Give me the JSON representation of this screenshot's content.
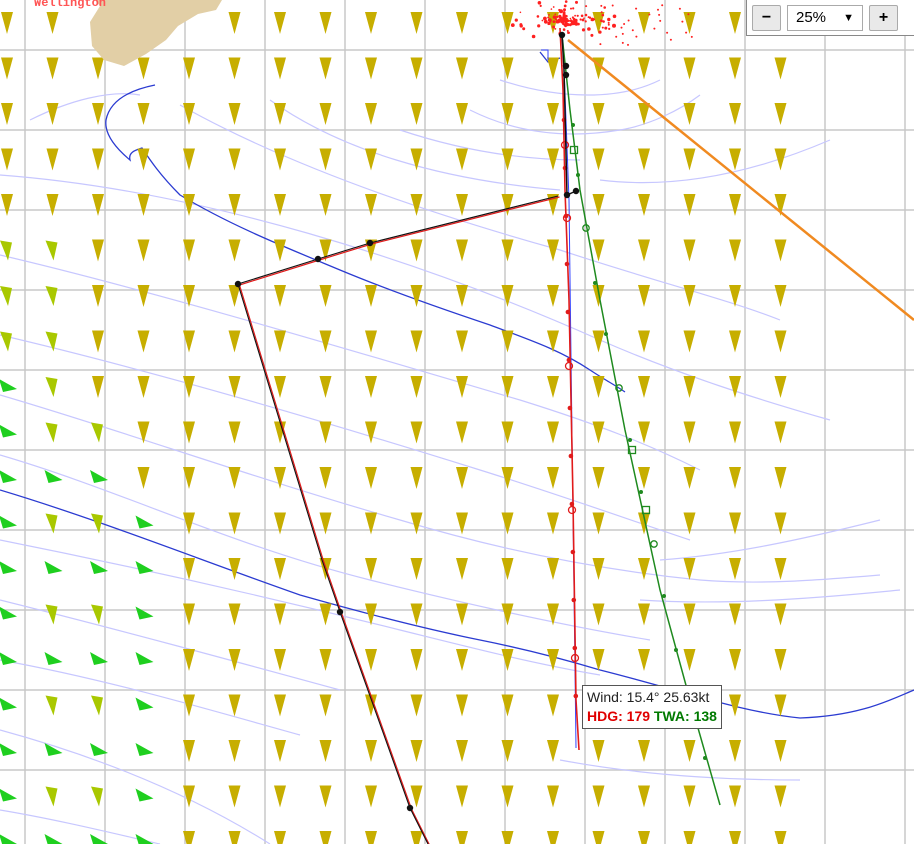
{
  "map": {
    "place_label": "Wellington",
    "colors": {
      "land": "#e2cfa6",
      "grid": "#c8c8c8",
      "isobar_light": "#c7c7ff",
      "isobar_dark": "#2b3bd1",
      "route_red": "#e11b1b",
      "route_green": "#1f8a1f",
      "route_black": "#111111",
      "route_orange": "#f08a21",
      "barb_yellow": "#c7ae00",
      "barb_green": "#1fcf1f",
      "fleet_dots": "#ff2020"
    }
  },
  "zoom": {
    "minus_label": "−",
    "value": "25%",
    "plus_label": "+",
    "caret": "▼"
  },
  "tooltip": {
    "wind_text": "Wind: 15.4° 25.63kt",
    "hdg_text": "HDG: 179",
    "twa_text": "TWA: 138"
  }
}
